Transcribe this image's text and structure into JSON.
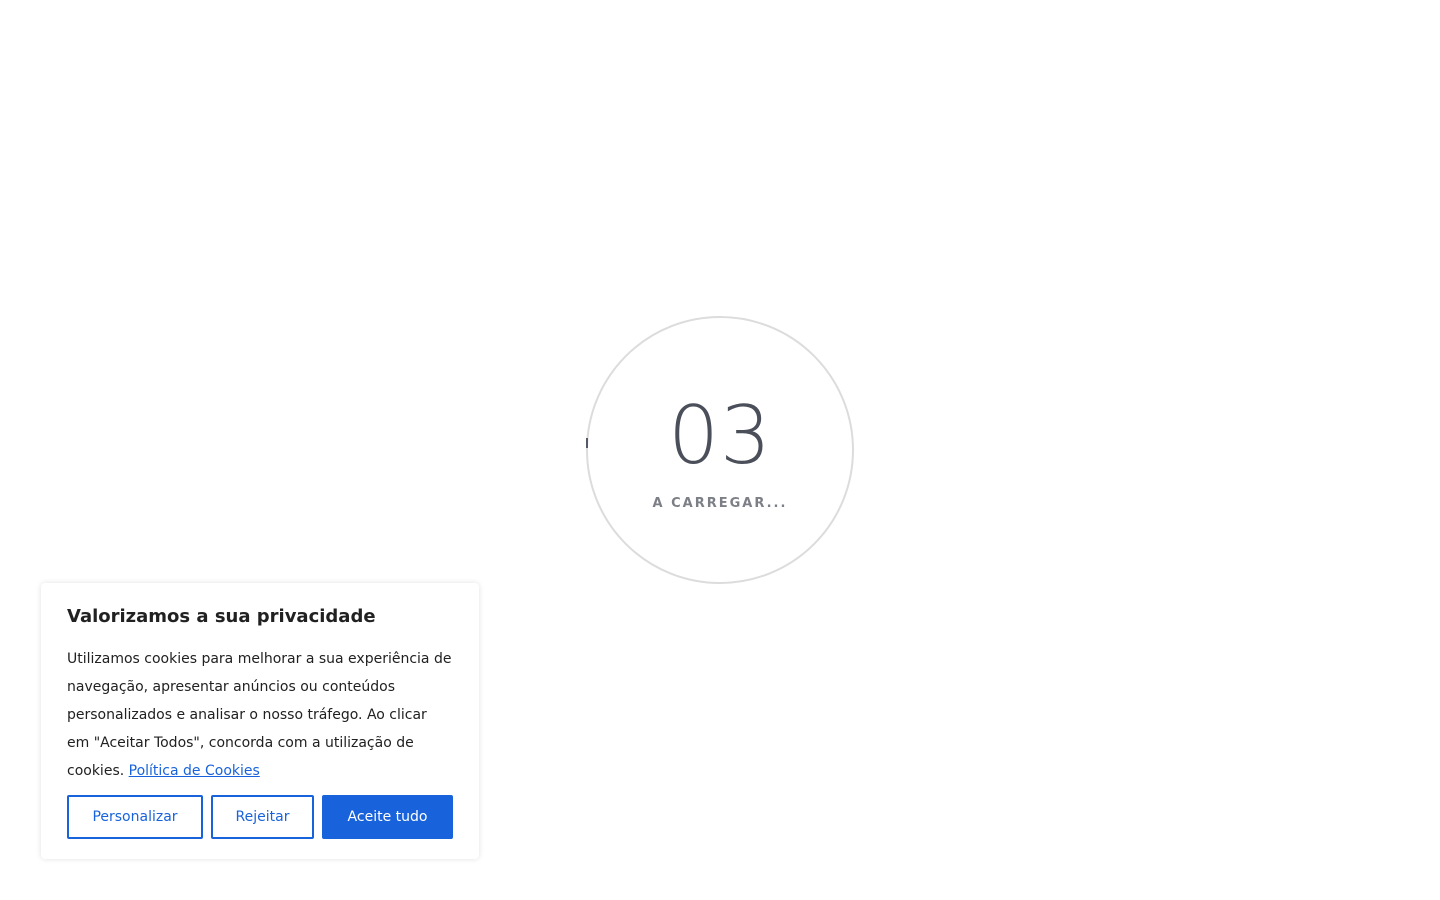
{
  "loader": {
    "number": "03",
    "label": "A CARREGAR..."
  },
  "cookie_banner": {
    "title": "Valorizamos a sua privacidade",
    "text": "Utilizamos cookies para melhorar a sua experiência de navegação, apresentar anúncios ou conteúdos personalizados e analisar o nosso tráfego. Ao clicar em \"Aceitar Todos\", concorda com a utilização de cookies.",
    "policy_link": "Política de Cookies",
    "buttons": {
      "customize": "Personalizar",
      "reject": "Rejeitar",
      "accept": "Aceite tudo"
    }
  },
  "colors": {
    "accent": "#1863dc",
    "loader_ring": "#dcdcdc",
    "loader_text": "#4a4f5a"
  }
}
